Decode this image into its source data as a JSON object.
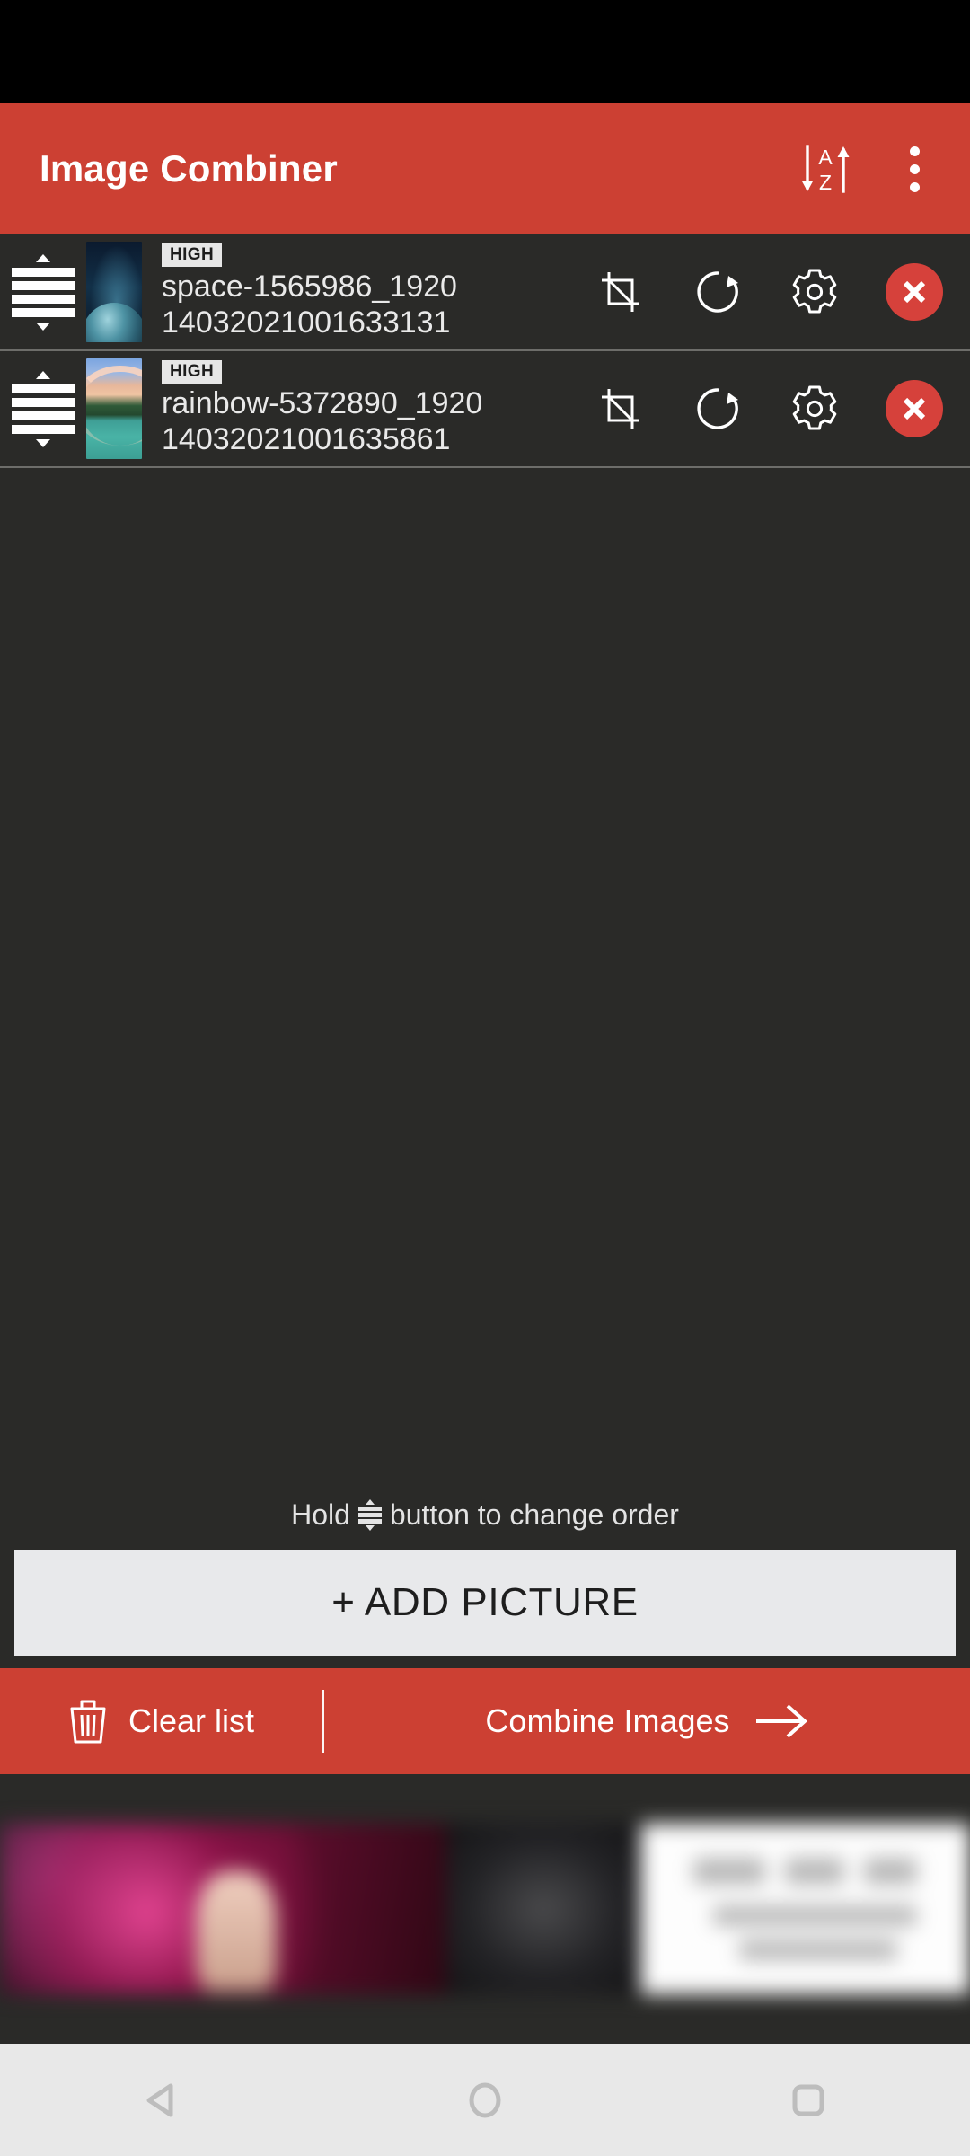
{
  "app": {
    "title": "Image Combiner",
    "accent_color": "#cc4033",
    "background_color": "#2a2a28"
  },
  "appbar": {
    "sort_icon": "sort-az-icon",
    "overflow_icon": "overflow-menu-icon"
  },
  "list": {
    "items": [
      {
        "badge": "HIGH",
        "filename_line1": "space-1565986_1920",
        "filename_line2": "14032021001633131",
        "thumbnail": "space-thumbnail",
        "drag_handle": "drag-handle-icon",
        "actions": [
          "crop-icon",
          "rotate-icon",
          "settings-icon",
          "delete-icon"
        ]
      },
      {
        "badge": "HIGH",
        "filename_line1": "rainbow-5372890_1920",
        "filename_line2": "14032021001635861",
        "thumbnail": "rainbow-thumbnail",
        "drag_handle": "drag-handle-icon",
        "actions": [
          "crop-icon",
          "rotate-icon",
          "settings-icon",
          "delete-icon"
        ]
      }
    ]
  },
  "hint": {
    "text_before": "Hold",
    "text_after": "button to change order"
  },
  "add_picture": {
    "label": "+ ADD PICTURE"
  },
  "bottom_bar": {
    "clear_label": "Clear list",
    "clear_icon": "trash-icon",
    "combine_label": "Combine Images",
    "combine_icon": "arrow-right-icon"
  },
  "ad": {
    "region": "advertisement-banner"
  },
  "navbar": {
    "back": "back-triangle-icon",
    "home": "home-circle-icon",
    "recents": "recents-square-icon"
  }
}
